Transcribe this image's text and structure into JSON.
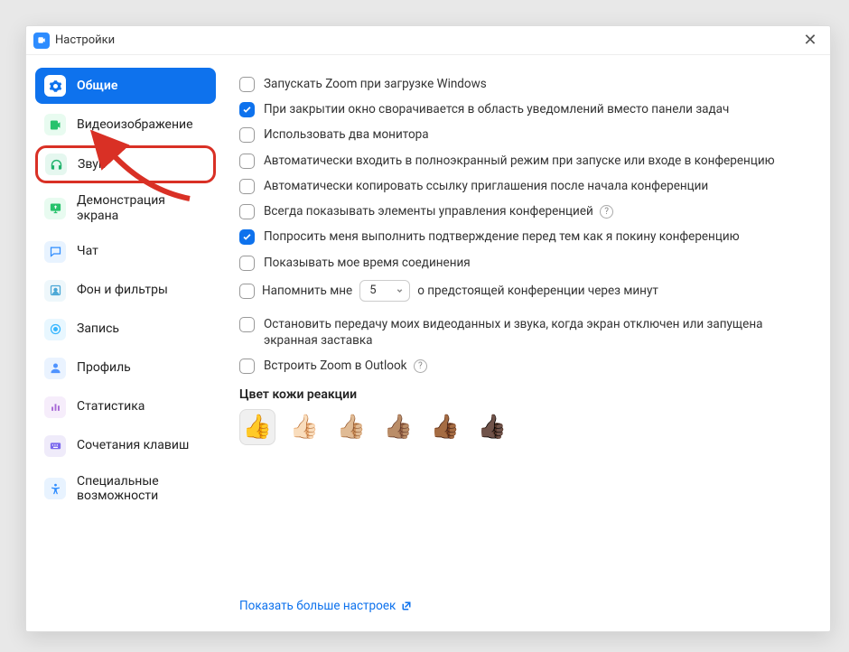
{
  "window": {
    "title": "Настройки"
  },
  "sidebar": {
    "items": [
      {
        "label": "Общие",
        "active": true,
        "icon": "gear-icon"
      },
      {
        "label": "Видеоизображение",
        "icon": "video-icon"
      },
      {
        "label": "Звук",
        "icon": "headphones-icon",
        "highlighted": true
      },
      {
        "label": "Демонстрация экрана",
        "icon": "share-screen-icon"
      },
      {
        "label": "Чат",
        "icon": "chat-icon"
      },
      {
        "label": "Фон и фильтры",
        "icon": "background-icon"
      },
      {
        "label": "Запись",
        "icon": "record-icon"
      },
      {
        "label": "Профиль",
        "icon": "profile-icon"
      },
      {
        "label": "Статистика",
        "icon": "statistics-icon"
      },
      {
        "label": "Сочетания клавиш",
        "icon": "keyboard-icon"
      },
      {
        "label": "Специальные возможности",
        "icon": "accessibility-icon"
      }
    ]
  },
  "options": {
    "start_on_boot": {
      "label": "Запускать Zoom при загрузке Windows",
      "checked": false
    },
    "minimize_to_tray": {
      "label": "При закрытии окно сворачивается в область уведомлений вместо панели задач",
      "checked": true
    },
    "dual_monitors": {
      "label": "Использовать два монитора",
      "checked": false
    },
    "fullscreen_on_join": {
      "label": "Автоматически входить в полноэкранный режим при запуске или входе в конференцию",
      "checked": false
    },
    "auto_copy_invite": {
      "label": "Автоматически копировать ссылку приглашения после начала конференции",
      "checked": false
    },
    "always_show_controls": {
      "label": "Всегда показывать элементы управления конференцией",
      "checked": false,
      "help": true
    },
    "confirm_leave": {
      "label": "Попросить меня выполнить подтверждение перед тем как я покину конференцию",
      "checked": true
    },
    "show_connect_time": {
      "label": "Показывать мое время соединения",
      "checked": false
    },
    "remind": {
      "prefix": "Напомнить мне",
      "value": "5",
      "suffix": "о предстоящей конференции через минут",
      "checked": false
    },
    "stop_av_on_lock": {
      "label": "Остановить передачу моих видеоданных и звука, когда экран отключен или запущена экранная заставка",
      "checked": false
    },
    "outlook_integration": {
      "label": "Встроить Zoom в Outlook",
      "checked": false,
      "help": true
    }
  },
  "skin_tone": {
    "title": "Цвет кожи реакции",
    "options": [
      "👍",
      "👍🏻",
      "👍🏼",
      "👍🏽",
      "👍🏾",
      "👍🏿"
    ],
    "selected_index": 0
  },
  "footer": {
    "more_settings": "Показать больше настроек"
  }
}
